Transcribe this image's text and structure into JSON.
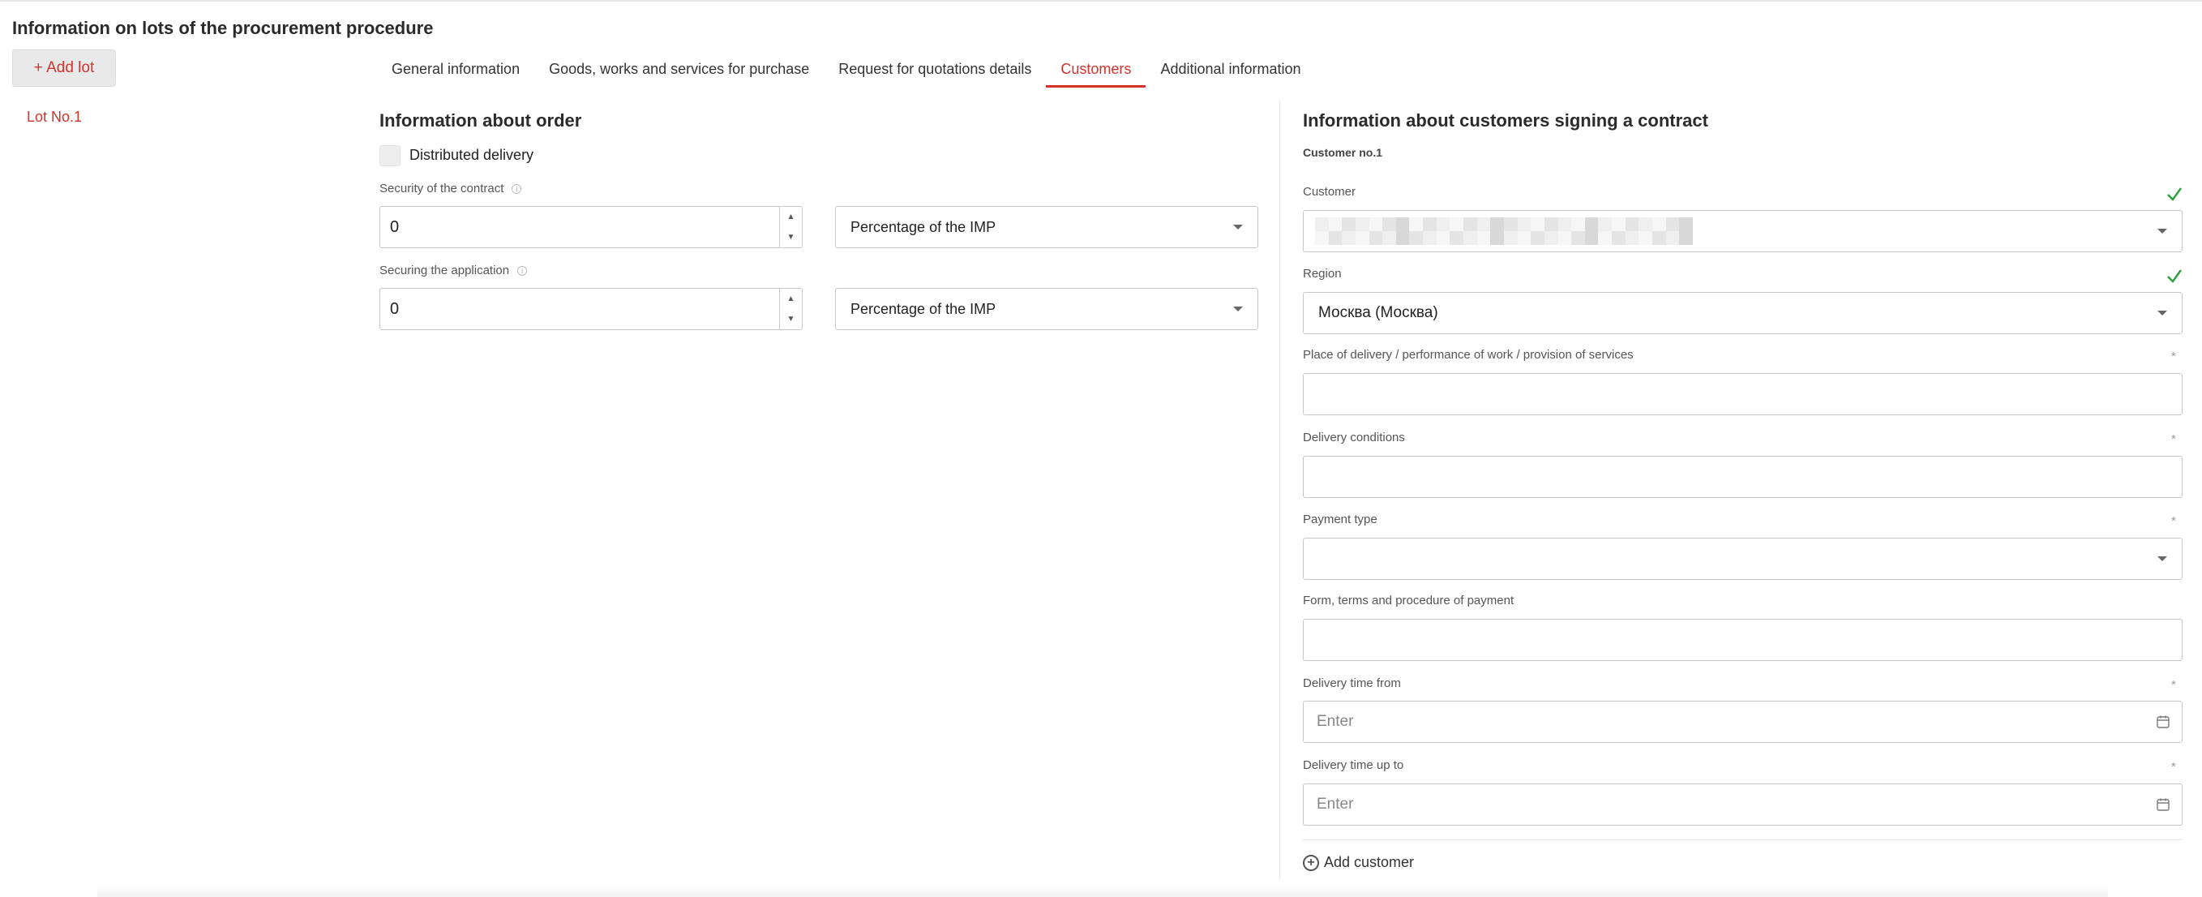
{
  "page": {
    "title": "Information on lots of the procurement procedure"
  },
  "lots": {
    "add_label": "+ Add lot",
    "items": [
      {
        "label": "Lot No.1"
      }
    ]
  },
  "tabs": [
    {
      "label": "General information"
    },
    {
      "label": "Goods, works and services for purchase"
    },
    {
      "label": "Request for quotations details"
    },
    {
      "label": "Customers",
      "active": true
    },
    {
      "label": "Additional information"
    }
  ],
  "order": {
    "title": "Information about order",
    "distributed_delivery_label": "Distributed delivery",
    "security_contract": {
      "label": "Security of the contract",
      "value": "0",
      "unit": "Percentage of the IMP"
    },
    "securing_application": {
      "label": "Securing the application",
      "value": "0",
      "unit": "Percentage of the IMP"
    }
  },
  "customers": {
    "title": "Information about customers signing a contract",
    "customer_no": "Customer no.1",
    "fields": {
      "customer": {
        "label": "Customer"
      },
      "region": {
        "label": "Region",
        "value": "Москва (Москва)"
      },
      "place": {
        "label": "Place of delivery / performance of work / provision of services"
      },
      "conditions": {
        "label": "Delivery conditions"
      },
      "payment_type": {
        "label": "Payment type"
      },
      "payment_form": {
        "label": "Form, terms and procedure of payment"
      },
      "time_from": {
        "label": "Delivery time from",
        "placeholder": "Enter"
      },
      "time_to": {
        "label": "Delivery time up to",
        "placeholder": "Enter"
      }
    },
    "add_label": "Add customer",
    "required_mark": "*"
  },
  "colors": {
    "accent": "#d0342c",
    "check": "#2e9e3e"
  }
}
